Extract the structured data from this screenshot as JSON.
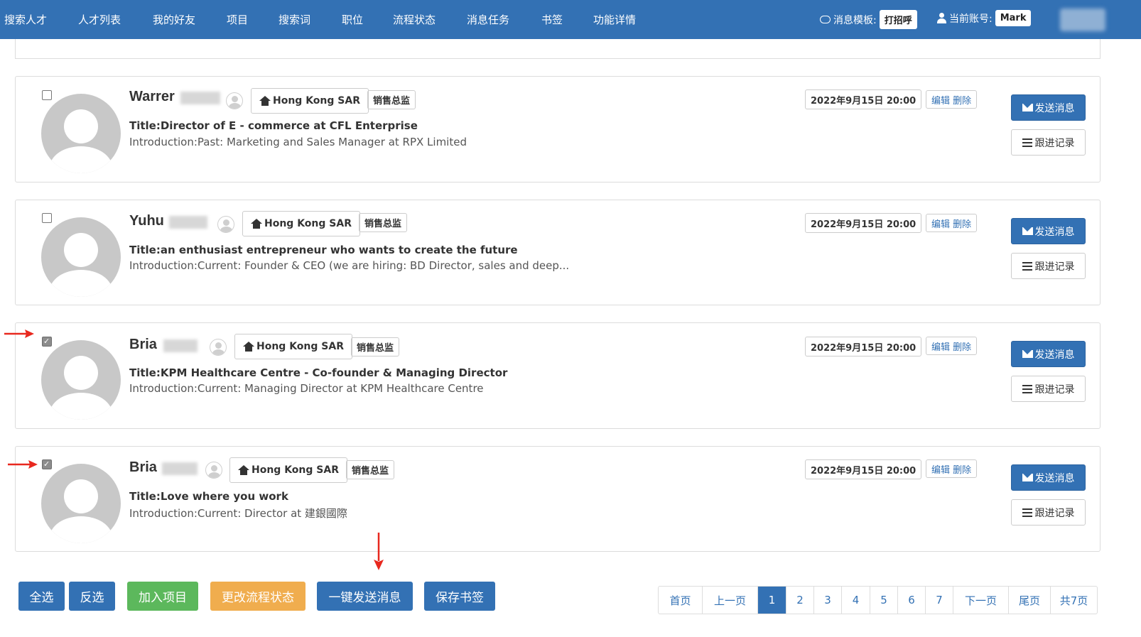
{
  "nav": {
    "items": [
      "搜索人才",
      "人才列表",
      "我的好友",
      "项目",
      "搜索词",
      "职位",
      "流程状态",
      "消息任务",
      "书签",
      "功能详情"
    ],
    "template_label": "消息模板:",
    "template_value": "打招呼",
    "account_label": "当前账号:",
    "account_value": "Mark"
  },
  "candidates": [
    {
      "name": "Warrer",
      "location": "Hong Kong SAR",
      "role": "销售总监",
      "title": "Title:Director of E - commerce at CFL Enterprise",
      "intro": "Introduction:Past: Marketing and Sales Manager at RPX Limited",
      "date": "2022年9月15日 20:00",
      "checked": false
    },
    {
      "name": "Yuhu",
      "location": "Hong Kong SAR",
      "role": "销售总监",
      "title": "Title:an enthusiast entrepreneur who wants to create the future",
      "intro": "Introduction:Current: Founder & CEO (we are hiring: BD Director, sales and deep...",
      "date": "2022年9月15日 20:00",
      "checked": false
    },
    {
      "name": "Bria",
      "location": "Hong Kong SAR",
      "role": "销售总监",
      "title": "Title:KPM Healthcare Centre - Co-founder & Managing Director",
      "intro": "Introduction:Current: Managing Director at KPM Healthcare Centre",
      "date": "2022年9月15日 20:00",
      "checked": true
    },
    {
      "name": "Bria",
      "location": "Hong Kong SAR",
      "role": "销售总监",
      "title": "Title:Love where you work",
      "intro": "Introduction:Current: Director at 建銀國際",
      "date": "2022年9月15日 20:00",
      "checked": true
    }
  ],
  "card_actions": {
    "edit": "编辑",
    "delete": "删除",
    "send": "发送消息",
    "follow": "跟进记录"
  },
  "bottom_buttons": {
    "select_all": "全选",
    "invert": "反选",
    "add_project": "加入项目",
    "change_status": "更改流程状态",
    "send_all": "一键发送消息",
    "save_bookmark": "保存书签"
  },
  "colors": {
    "primary": "#3371b4",
    "success": "#5cb85c",
    "warning": "#f0ad4e",
    "arrow": "#e8281e"
  },
  "pagination": {
    "first": "首页",
    "prev": "上一页",
    "pages": [
      "1",
      "2",
      "3",
      "4",
      "5",
      "6",
      "7"
    ],
    "current": "1",
    "next": "下一页",
    "last": "尾页",
    "total": "共7页"
  }
}
